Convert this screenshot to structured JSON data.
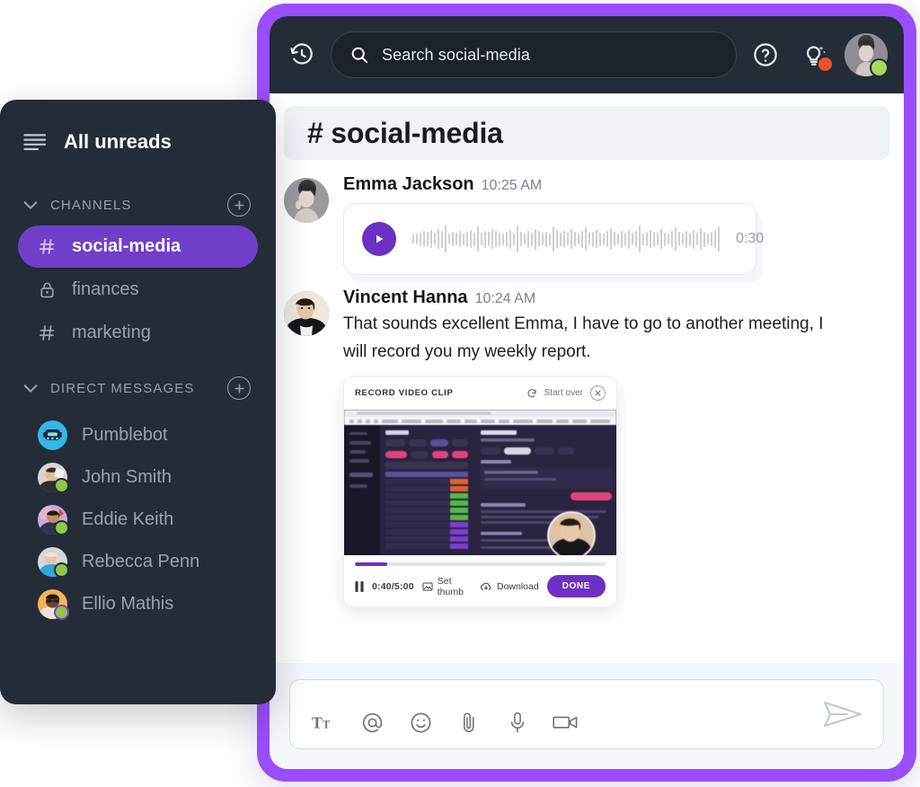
{
  "theme": {
    "frame_purple": "#9a4dfc",
    "sidebar_bg": "#242c38",
    "accent_purple": "#6d30c4",
    "active_channel_bg": "#6f3fc9",
    "online_green": "#8fc64a",
    "alert_orange": "#f0502a"
  },
  "topbar": {
    "history_icon": "history-clock-icon",
    "search": {
      "icon": "search-icon",
      "placeholder": "Search social-media",
      "value": ""
    },
    "help_icon": "help-question-icon",
    "ideas_icon": "lightbulb-sparkle-icon",
    "ideas_badge": "",
    "avatar_name": "user-avatar",
    "avatar_status": "online"
  },
  "sidebar": {
    "menu_icon": "hamburger-menu-icon",
    "title": "All unreads",
    "sections": [
      {
        "id": "channels",
        "label": "CHANNELS",
        "collapse_icon": "chevron-down-icon",
        "add_icon": "plus-circle-icon",
        "items": [
          {
            "glyph": "#",
            "icon": "hash-icon",
            "label": "social-media",
            "active": true
          },
          {
            "glyph": "🔒",
            "icon": "lock-icon",
            "label": "finances",
            "active": false
          },
          {
            "glyph": "#",
            "icon": "hash-icon",
            "label": "marketing",
            "active": false
          }
        ]
      },
      {
        "id": "direct-messages",
        "label": "DIRECT MESSAGES",
        "collapse_icon": "chevron-down-icon",
        "add_icon": "plus-circle-icon",
        "items": [
          {
            "label": "Pumblebot",
            "online": false,
            "avatar": "bot"
          },
          {
            "label": "John Smith",
            "online": true,
            "avatar": "photo"
          },
          {
            "label": "Eddie Keith",
            "online": true,
            "avatar": "photo"
          },
          {
            "label": "Rebecca Penn",
            "online": true,
            "avatar": "photo"
          },
          {
            "label": "Ellio Mathis",
            "online": true,
            "avatar": "photo"
          }
        ]
      }
    ]
  },
  "channel": {
    "hash": "#",
    "name": "social-media",
    "title": "# social-media"
  },
  "messages": [
    {
      "author": "Emma Jackson",
      "time": "10:25 AM",
      "text": "",
      "attachment": "voice-note"
    },
    {
      "author": "Vincent Hanna",
      "time": "10:24 AM",
      "text": "That sounds excellent Emma, I have to go to another meeting, I will record you my weekly report.",
      "attachment": "video-clip"
    }
  ],
  "voice_note": {
    "play_icon": "play-icon",
    "duration": "0:30"
  },
  "video_clip": {
    "title": "RECORD VIDEO CLIP",
    "start_over_label": "Start over",
    "start_over_icon": "refresh-icon",
    "close_icon": "close-circle-icon",
    "progress_percent": 13,
    "pause_icon": "pause-icon",
    "time": "0:40/5:00",
    "set_thumb_label": "Set thumb",
    "set_thumb_icon": "image-icon",
    "download_label": "Download",
    "download_icon": "cloud-download-icon",
    "done_label": "DONE"
  },
  "composer": {
    "placeholder": "",
    "value": "",
    "tools": [
      {
        "icon": "text-format-icon",
        "label": "Tt"
      },
      {
        "icon": "mention-at-icon",
        "label": "@"
      },
      {
        "icon": "emoji-smiley-icon",
        "label": "☺"
      },
      {
        "icon": "attachment-paperclip-icon",
        "label": "paperclip"
      },
      {
        "icon": "microphone-icon",
        "label": "mic"
      },
      {
        "icon": "video-camera-icon",
        "label": "camera"
      }
    ],
    "send_icon": "send-paper-plane-icon"
  }
}
